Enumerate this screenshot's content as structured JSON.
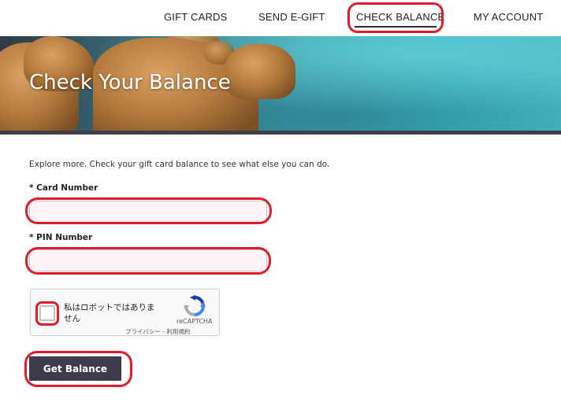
{
  "nav": {
    "items": [
      {
        "label": "GIFT CARDS"
      },
      {
        "label": "SEND E-GIFT"
      },
      {
        "label": "CHECK BALANCE"
      },
      {
        "label": "MY ACCOUNT"
      }
    ],
    "active": "CHECK BALANCE"
  },
  "hero": {
    "title": "Check Your Balance"
  },
  "form": {
    "intro": "Explore more. Check your gift card balance to see what else you can do.",
    "card_number": {
      "label": "* Card Number",
      "value": "",
      "placeholder": ""
    },
    "pin_number": {
      "label": "* PIN Number",
      "value": "",
      "placeholder": ""
    },
    "captcha": {
      "checkbox_label": "私はロボットではありません",
      "brand": "reCAPTCHA",
      "privacy_link": "プライバシー",
      "separator": " - ",
      "terms_link": "利用規約",
      "checked": false
    },
    "submit_label": "Get Balance"
  },
  "colors": {
    "hero_bar": "#3f3e4d",
    "button_bg": "#3e3b4d",
    "annotation": "#dd1d2a"
  }
}
